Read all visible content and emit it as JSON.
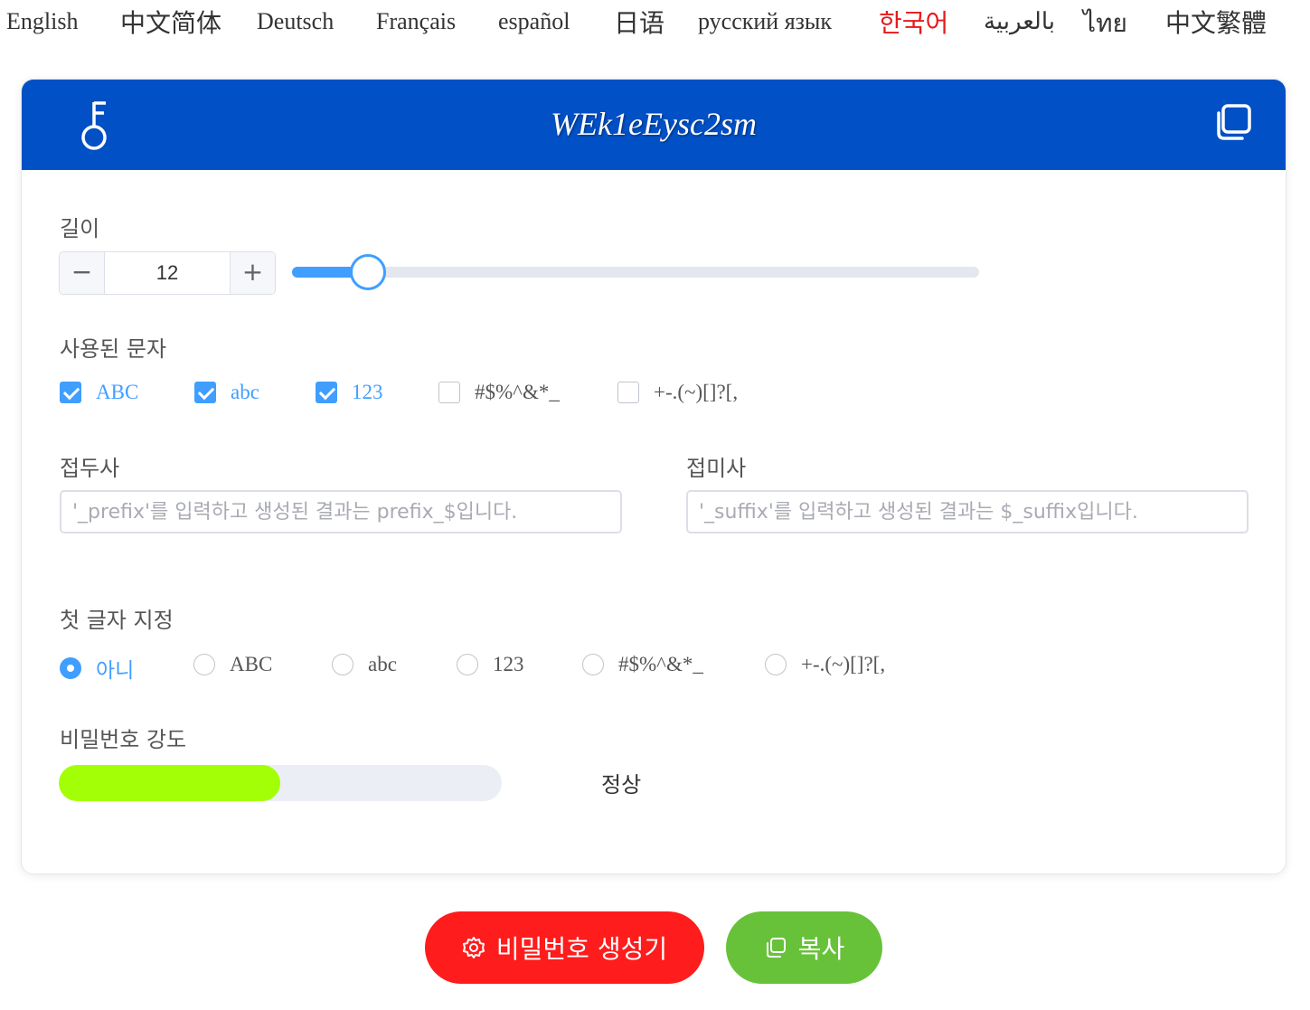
{
  "languages": [
    {
      "label": "English",
      "active": false
    },
    {
      "label": "中文简体",
      "active": false
    },
    {
      "label": "Deutsch",
      "active": false
    },
    {
      "label": "Français",
      "active": false
    },
    {
      "label": "español",
      "active": false
    },
    {
      "label": "日语",
      "active": false
    },
    {
      "label": "русский язык",
      "active": false
    },
    {
      "label": "한국어",
      "active": true
    },
    {
      "label": "بالعربية",
      "active": false
    },
    {
      "label": "ไทย",
      "active": false
    },
    {
      "label": "中文繁體",
      "active": false
    }
  ],
  "header": {
    "password": "WEk1eEysc2sm",
    "key_icon": "key-icon",
    "copy_icon": "copy-icon",
    "background": "#0150c6"
  },
  "length": {
    "label": "길이",
    "value": "12",
    "minus": "−",
    "plus": "+",
    "slider_fraction": 0.11
  },
  "charset": {
    "label": "사용된 문자",
    "options": [
      {
        "label": "ABC",
        "checked": true
      },
      {
        "label": "abc",
        "checked": true
      },
      {
        "label": "123",
        "checked": true
      },
      {
        "label": "#$%^&*_",
        "checked": false
      },
      {
        "label": "+-.(~)[]?[,",
        "checked": false
      }
    ]
  },
  "prefix": {
    "label": "접두사",
    "value": "",
    "placeholder": "'_prefix'를 입력하고 생성된 결과는 prefix_$입니다."
  },
  "suffix": {
    "label": "접미사",
    "value": "",
    "placeholder": "'_suffix'를 입력하고 생성된 결과는 $_suffix입니다."
  },
  "first_char": {
    "label": "첫 글자 지정",
    "options": [
      {
        "label": "아니",
        "checked": true
      },
      {
        "label": "ABC",
        "checked": false
      },
      {
        "label": "abc",
        "checked": false
      },
      {
        "label": "123",
        "checked": false
      },
      {
        "label": "#$%^&*_",
        "checked": false
      },
      {
        "label": "+-.(~)[]?[,",
        "checked": false
      }
    ]
  },
  "strength": {
    "label": "비밀번호 강도",
    "level_fraction": 0.5,
    "text": "정상",
    "color": "#a3ff06"
  },
  "buttons": {
    "generate": {
      "label": "비밀번호 생성기",
      "icon": "gear-icon",
      "color": "#fe1c1c"
    },
    "copy": {
      "label": "복사",
      "icon": "copy-icon",
      "color": "#67c23a"
    }
  },
  "colors": {
    "accent": "#409eff",
    "active_language": "#e8181b"
  }
}
